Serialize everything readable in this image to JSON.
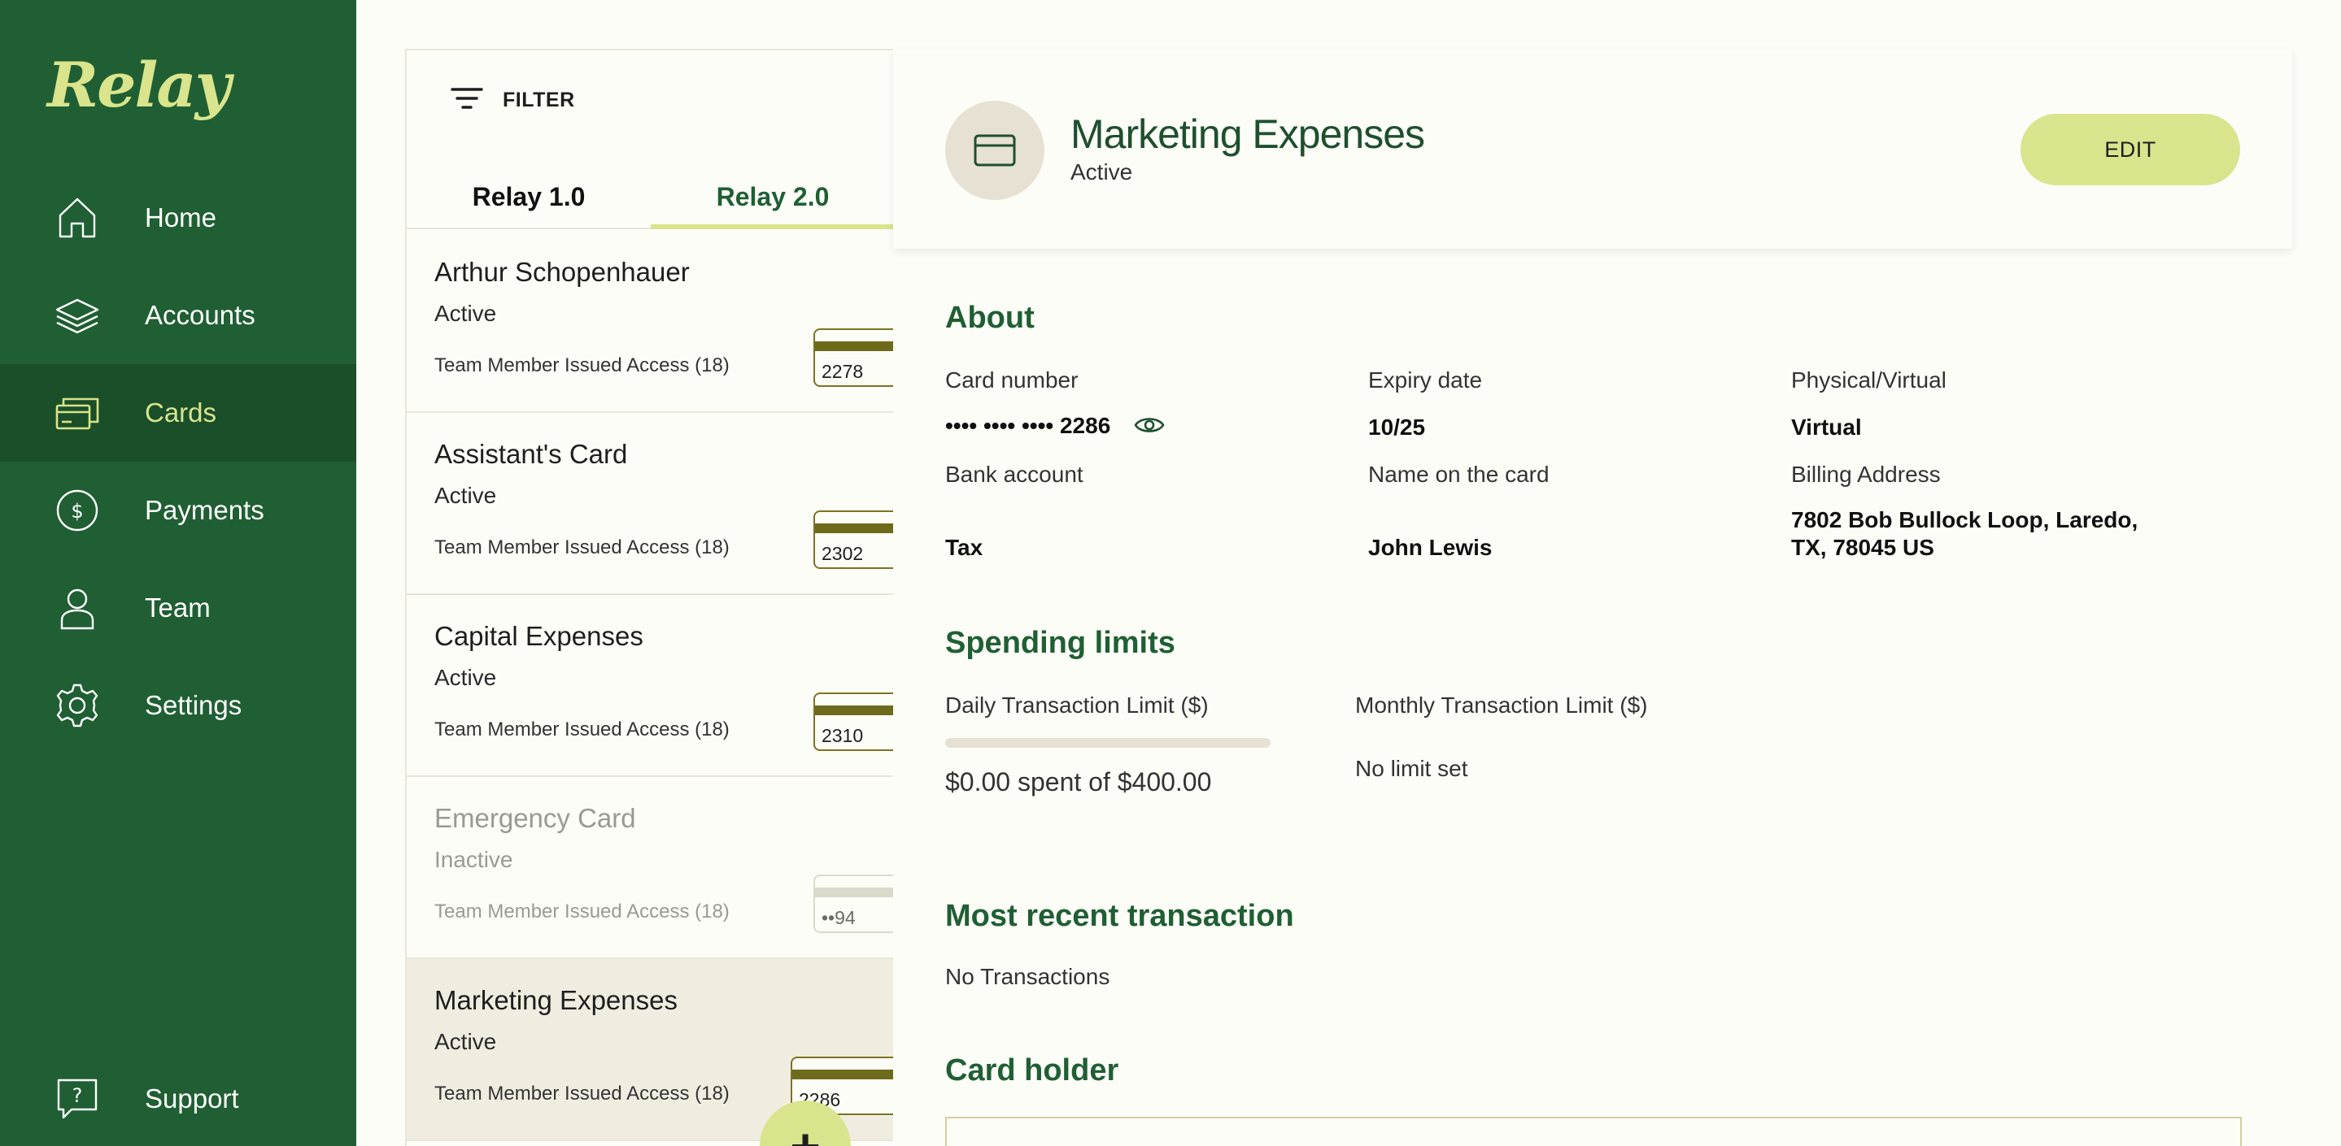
{
  "app": {
    "logo": "Relay"
  },
  "sidebar": {
    "items": [
      {
        "label": "Home",
        "icon": "home-icon"
      },
      {
        "label": "Accounts",
        "icon": "layers-icon"
      },
      {
        "label": "Cards",
        "icon": "cards-icon",
        "active": true
      },
      {
        "label": "Payments",
        "icon": "dollar-circle-icon"
      },
      {
        "label": "Team",
        "icon": "person-icon"
      },
      {
        "label": "Settings",
        "icon": "gear-icon"
      }
    ],
    "support": {
      "label": "Support",
      "icon": "help-chat-icon"
    }
  },
  "list": {
    "filter_label": "FILTER",
    "tabs": [
      {
        "label": "Relay 1.0"
      },
      {
        "label": "Relay 2.0",
        "active": true
      }
    ],
    "cards": [
      {
        "name": "Arthur Schopenhauer",
        "status": "Active",
        "access": "Team Member Issued Access (18)",
        "last4": "2278"
      },
      {
        "name": "Assistant's Card",
        "status": "Active",
        "access": "Team Member Issued Access (18)",
        "last4": "2302"
      },
      {
        "name": "Capital Expenses",
        "status": "Active",
        "access": "Team Member Issued Access (18)",
        "last4": "2310"
      },
      {
        "name": "Emergency Card",
        "status": "Inactive",
        "access": "Team Member Issued Access (18)",
        "last4": "••94"
      },
      {
        "name": "Marketing Expenses",
        "status": "Active",
        "access": "Team Member Issued Access (18)",
        "last4": "2286"
      }
    ],
    "fab_label": "+"
  },
  "detail": {
    "title": "Marketing Expenses",
    "status": "Active",
    "edit_label": "EDIT",
    "about": {
      "heading": "About",
      "card_number_label": "Card number",
      "card_number_value": "•••• •••• •••• 2286",
      "expiry_label": "Expiry date",
      "expiry_value": "10/25",
      "type_label": "Physical/Virtual",
      "type_value": "Virtual",
      "bank_label": "Bank account",
      "bank_value": "Tax",
      "name_label": "Name on the card",
      "name_value": "John Lewis",
      "billing_label": "Billing Address",
      "billing_line1": "7802 Bob Bullock Loop, Laredo,",
      "billing_line2": "TX, 78045 US"
    },
    "limits": {
      "heading": "Spending limits",
      "daily_label": "Daily Transaction Limit ($)",
      "daily_spent_fraction": 0,
      "daily_text": "$0.00 spent of $400.00",
      "monthly_label": "Monthly Transaction Limit ($)",
      "monthly_text": "No limit set"
    },
    "recent": {
      "heading": "Most recent transaction",
      "text": "No Transactions"
    },
    "holder": {
      "heading": "Card holder"
    }
  },
  "colors": {
    "sidebar_bg": "#1f5f33",
    "accent": "#d9e48c",
    "heading_green": "#1f5f33",
    "background": "#fdfdf8"
  }
}
